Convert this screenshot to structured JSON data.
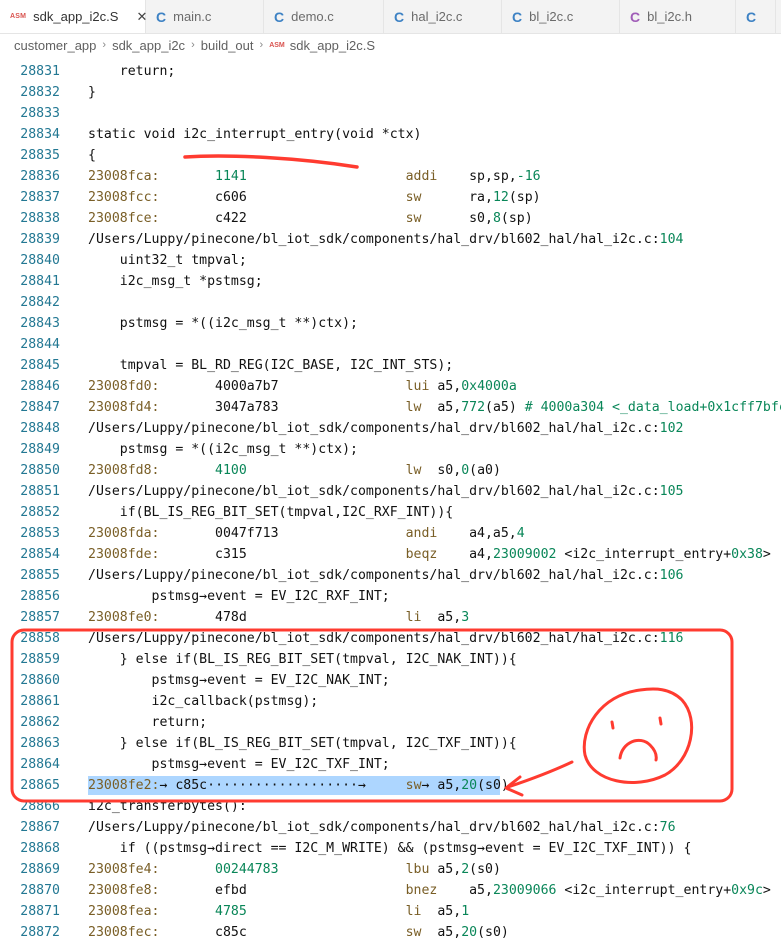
{
  "tabs": [
    {
      "icon": "ASM",
      "kind": "asm",
      "label": "sdk_app_i2c.S",
      "active": true
    },
    {
      "icon": "C",
      "kind": "c",
      "label": "main.c",
      "active": false
    },
    {
      "icon": "C",
      "kind": "c",
      "label": "demo.c",
      "active": false
    },
    {
      "icon": "C",
      "kind": "c",
      "label": "hal_i2c.c",
      "active": false
    },
    {
      "icon": "C",
      "kind": "c",
      "label": "bl_i2c.c",
      "active": false
    },
    {
      "icon": "C",
      "kind": "h",
      "label": "bl_i2c.h",
      "active": false
    }
  ],
  "tab_close_glyph": "✕",
  "breadcrumb": {
    "items": [
      "customer_app",
      "sdk_app_i2c",
      "build_out"
    ],
    "file_icon": "ASM",
    "file": "sdk_app_i2c.S",
    "separator": "›"
  },
  "editor": {
    "highlight_line": "28865",
    "lines": [
      {
        "n": "28831",
        "segs": [
          {
            "t": "    return;",
            "c": "plain"
          }
        ]
      },
      {
        "n": "28832",
        "segs": [
          {
            "t": "}",
            "c": "plain"
          }
        ]
      },
      {
        "n": "28833",
        "segs": []
      },
      {
        "n": "28834",
        "segs": [
          {
            "t": "static void i2c_interrupt_entry(void *ctx)",
            "c": "plain"
          }
        ]
      },
      {
        "n": "28835",
        "segs": [
          {
            "t": "{",
            "c": "plain"
          }
        ]
      },
      {
        "n": "28836",
        "segs": [
          {
            "t": "23008fca:",
            "c": "addr"
          },
          {
            "t": "\t1141",
            "c": "hex"
          },
          {
            "t": "                \taddi",
            "c": "mnem"
          },
          {
            "t": "\tsp,sp,",
            "c": "plain"
          },
          {
            "t": "-16",
            "c": "num"
          }
        ]
      },
      {
        "n": "28837",
        "segs": [
          {
            "t": "23008fcc:",
            "c": "addr"
          },
          {
            "t": "\tc606",
            "c": "plain"
          },
          {
            "t": "                \tsw",
            "c": "mnem"
          },
          {
            "t": "\tra,",
            "c": "plain"
          },
          {
            "t": "12",
            "c": "num"
          },
          {
            "t": "(sp)",
            "c": "plain"
          }
        ]
      },
      {
        "n": "28838",
        "segs": [
          {
            "t": "23008fce:",
            "c": "addr"
          },
          {
            "t": "\tc422",
            "c": "plain"
          },
          {
            "t": "                \tsw",
            "c": "mnem"
          },
          {
            "t": "\ts0,",
            "c": "plain"
          },
          {
            "t": "8",
            "c": "num"
          },
          {
            "t": "(sp)",
            "c": "plain"
          }
        ]
      },
      {
        "n": "28839",
        "segs": [
          {
            "t": "/Users/Luppy/pinecone/bl_iot_sdk/components/hal_drv/bl602_hal/hal_i2c.c:",
            "c": "plain"
          },
          {
            "t": "104",
            "c": "num"
          }
        ]
      },
      {
        "n": "28840",
        "segs": [
          {
            "t": "    uint32_t tmpval;",
            "c": "plain"
          }
        ]
      },
      {
        "n": "28841",
        "segs": [
          {
            "t": "    i2c_msg_t *pstmsg;",
            "c": "plain"
          }
        ]
      },
      {
        "n": "28842",
        "segs": []
      },
      {
        "n": "28843",
        "segs": [
          {
            "t": "    pstmsg = *((i2c_msg_t **)ctx);",
            "c": "plain"
          }
        ]
      },
      {
        "n": "28844",
        "segs": []
      },
      {
        "n": "28845",
        "segs": [
          {
            "t": "    tmpval = BL_RD_REG(I2C_BASE, I2C_INT_STS);",
            "c": "plain"
          }
        ]
      },
      {
        "n": "28846",
        "segs": [
          {
            "t": "23008fd0:",
            "c": "addr"
          },
          {
            "t": "\t4000a7b7",
            "c": "plain"
          },
          {
            "t": "          \tlui",
            "c": "mnem"
          },
          {
            "t": " a5,",
            "c": "plain"
          },
          {
            "t": "0x4000a",
            "c": "num"
          }
        ]
      },
      {
        "n": "28847",
        "segs": [
          {
            "t": "23008fd4:",
            "c": "addr"
          },
          {
            "t": "\t3047a783",
            "c": "plain"
          },
          {
            "t": "          \tlw",
            "c": "mnem"
          },
          {
            "t": "  a5,",
            "c": "plain"
          },
          {
            "t": "772",
            "c": "num"
          },
          {
            "t": "(a5)",
            "c": "plain"
          },
          {
            "t": " # 4000a304 <_data_load+0x1cff7bfc>",
            "c": "num"
          }
        ]
      },
      {
        "n": "28848",
        "segs": [
          {
            "t": "/Users/Luppy/pinecone/bl_iot_sdk/components/hal_drv/bl602_hal/hal_i2c.c:",
            "c": "plain"
          },
          {
            "t": "102",
            "c": "num"
          }
        ]
      },
      {
        "n": "28849",
        "segs": [
          {
            "t": "    pstmsg = *((i2c_msg_t **)ctx);",
            "c": "plain"
          }
        ]
      },
      {
        "n": "28850",
        "segs": [
          {
            "t": "23008fd8:",
            "c": "addr"
          },
          {
            "t": "\t4100",
            "c": "hex"
          },
          {
            "t": "                \tlw",
            "c": "mnem"
          },
          {
            "t": "  s0,",
            "c": "plain"
          },
          {
            "t": "0",
            "c": "num"
          },
          {
            "t": "(a0)",
            "c": "plain"
          }
        ]
      },
      {
        "n": "28851",
        "segs": [
          {
            "t": "/Users/Luppy/pinecone/bl_iot_sdk/components/hal_drv/bl602_hal/hal_i2c.c:",
            "c": "plain"
          },
          {
            "t": "105",
            "c": "num"
          }
        ]
      },
      {
        "n": "28852",
        "segs": [
          {
            "t": "    if(BL_IS_REG_BIT_SET(tmpval,I2C_RXF_INT)){",
            "c": "plain"
          }
        ]
      },
      {
        "n": "28853",
        "segs": [
          {
            "t": "23008fda:",
            "c": "addr"
          },
          {
            "t": "\t0047f713",
            "c": "plain"
          },
          {
            "t": "          \tandi",
            "c": "mnem"
          },
          {
            "t": "\ta4,a5,",
            "c": "plain"
          },
          {
            "t": "4",
            "c": "num"
          }
        ]
      },
      {
        "n": "28854",
        "segs": [
          {
            "t": "23008fde:",
            "c": "addr"
          },
          {
            "t": "\tc315",
            "c": "plain"
          },
          {
            "t": "                \tbeqz",
            "c": "mnem"
          },
          {
            "t": "\ta4,",
            "c": "plain"
          },
          {
            "t": "23009002",
            "c": "num"
          },
          {
            "t": " <i2c_interrupt_entry+",
            "c": "plain"
          },
          {
            "t": "0x38",
            "c": "num"
          },
          {
            "t": ">",
            "c": "plain"
          }
        ]
      },
      {
        "n": "28855",
        "segs": [
          {
            "t": "/Users/Luppy/pinecone/bl_iot_sdk/components/hal_drv/bl602_hal/hal_i2c.c:",
            "c": "plain"
          },
          {
            "t": "106",
            "c": "num"
          }
        ]
      },
      {
        "n": "28856",
        "segs": [
          {
            "t": "        pstmsg→event = EV_I2C_RXF_INT;",
            "c": "plain"
          }
        ]
      },
      {
        "n": "28857",
        "segs": [
          {
            "t": "23008fe0:",
            "c": "addr"
          },
          {
            "t": "\t478d",
            "c": "plain"
          },
          {
            "t": "                \tli",
            "c": "mnem"
          },
          {
            "t": "  a5,",
            "c": "plain"
          },
          {
            "t": "3",
            "c": "num"
          }
        ]
      },
      {
        "n": "28858",
        "segs": [
          {
            "t": "/Users/Luppy/pinecone/bl_iot_sdk/components/hal_drv/bl602_hal/hal_i2c.c:",
            "c": "plain"
          },
          {
            "t": "116",
            "c": "num"
          }
        ]
      },
      {
        "n": "28859",
        "segs": [
          {
            "t": "    } else if(BL_IS_REG_BIT_SET(tmpval, I2C_NAK_INT)){",
            "c": "plain"
          }
        ]
      },
      {
        "n": "28860",
        "segs": [
          {
            "t": "        pstmsg→event = EV_I2C_NAK_INT;",
            "c": "plain"
          }
        ]
      },
      {
        "n": "28861",
        "segs": [
          {
            "t": "        i2c_callback(pstmsg);",
            "c": "plain"
          }
        ]
      },
      {
        "n": "28862",
        "segs": [
          {
            "t": "        return;",
            "c": "plain"
          }
        ]
      },
      {
        "n": "28863",
        "segs": [
          {
            "t": "    } else if(BL_IS_REG_BIT_SET(tmpval, I2C_TXF_INT)){",
            "c": "plain"
          }
        ]
      },
      {
        "n": "28864",
        "segs": [
          {
            "t": "        pstmsg→event = EV_I2C_TXF_INT;",
            "c": "plain"
          }
        ]
      },
      {
        "n": "28865",
        "segs": [
          {
            "t": "23008fe2:",
            "c": "addr"
          },
          {
            "t": "→ ",
            "c": "plain"
          },
          {
            "t": "c85c",
            "c": "plain"
          },
          {
            "t": "···················→     ",
            "c": "plain"
          },
          {
            "t": "sw",
            "c": "mnem"
          },
          {
            "t": "→ a5,",
            "c": "plain"
          },
          {
            "t": "20",
            "c": "num"
          },
          {
            "t": "(s0)",
            "c": "plain"
          }
        ]
      },
      {
        "n": "28866",
        "segs": [
          {
            "t": "i2c_transferbytes():",
            "c": "plain"
          }
        ]
      },
      {
        "n": "28867",
        "segs": [
          {
            "t": "/Users/Luppy/pinecone/bl_iot_sdk/components/hal_drv/bl602_hal/hal_i2c.c:",
            "c": "plain"
          },
          {
            "t": "76",
            "c": "num"
          }
        ]
      },
      {
        "n": "28868",
        "segs": [
          {
            "t": "    if ((pstmsg→direct == I2C_M_WRITE) && (pstmsg→event = EV_I2C_TXF_INT)) {",
            "c": "plain"
          }
        ]
      },
      {
        "n": "28869",
        "segs": [
          {
            "t": "23008fe4:",
            "c": "addr"
          },
          {
            "t": "\t00244783",
            "c": "hex"
          },
          {
            "t": "          \tlbu",
            "c": "mnem"
          },
          {
            "t": " a5,",
            "c": "plain"
          },
          {
            "t": "2",
            "c": "num"
          },
          {
            "t": "(s0)",
            "c": "plain"
          }
        ]
      },
      {
        "n": "28870",
        "segs": [
          {
            "t": "23008fe8:",
            "c": "addr"
          },
          {
            "t": "\tefbd",
            "c": "plain"
          },
          {
            "t": "                \tbnez",
            "c": "mnem"
          },
          {
            "t": "\ta5,",
            "c": "plain"
          },
          {
            "t": "23009066",
            "c": "num"
          },
          {
            "t": " <i2c_interrupt_entry+",
            "c": "plain"
          },
          {
            "t": "0x9c",
            "c": "num"
          },
          {
            "t": ">",
            "c": "plain"
          }
        ]
      },
      {
        "n": "28871",
        "segs": [
          {
            "t": "23008fea:",
            "c": "addr"
          },
          {
            "t": "\t4785",
            "c": "hex"
          },
          {
            "t": "                \tli",
            "c": "mnem"
          },
          {
            "t": "  a5,",
            "c": "plain"
          },
          {
            "t": "1",
            "c": "num"
          }
        ]
      },
      {
        "n": "28872",
        "segs": [
          {
            "t": "23008fec:",
            "c": "addr"
          },
          {
            "t": "\tc85c",
            "c": "plain"
          },
          {
            "t": "                \tsw",
            "c": "mnem"
          },
          {
            "t": "  a5,",
            "c": "plain"
          },
          {
            "t": "20",
            "c": "num"
          },
          {
            "t": "(s0)",
            "c": "plain"
          }
        ]
      }
    ]
  },
  "annotations": {
    "color": "#ff3b30",
    "shapes": [
      "underline-stroke",
      "highlight-box",
      "sad-face",
      "arrow"
    ]
  }
}
